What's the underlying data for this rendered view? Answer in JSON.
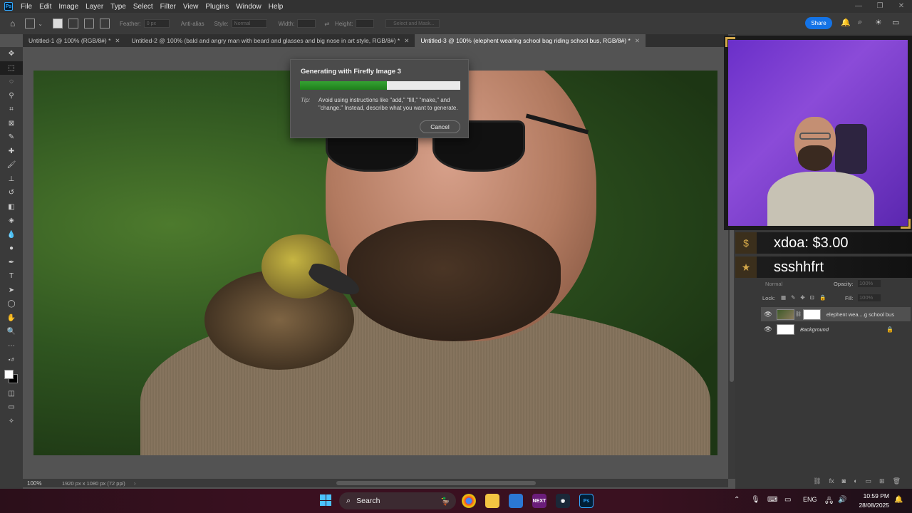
{
  "app": {
    "logo": "Ps",
    "menus": [
      "File",
      "Edit",
      "Image",
      "Layer",
      "Type",
      "Select",
      "Filter",
      "View",
      "Plugins",
      "Window",
      "Help"
    ]
  },
  "options_bar": {
    "feather_label": "Feather:",
    "feather_value": "0 px",
    "anti_alias_label": "Anti-alias",
    "style_label": "Style:",
    "style_value": "Normal",
    "width_label": "Width:",
    "height_label": "Height:",
    "select_mask_label": "Select and Mask...",
    "share_label": "Share"
  },
  "tabs": [
    {
      "label": "Untitled-1 @ 100% (RGB/8#) *",
      "active": false
    },
    {
      "label": "Untitled-2 @ 100% (bald and angry man with beard and glasses and big nose in art style, RGB/8#) *",
      "active": false
    },
    {
      "label": "Untitled-3 @ 100% (elephent wearing school bag riding school bus, RGB/8#) *",
      "active": true
    }
  ],
  "tools": [
    "move-tool",
    "marquee-tool",
    "lasso-tool",
    "object-select-tool",
    "crop-tool",
    "frame-tool",
    "eyedropper-tool",
    "spot-healing-tool",
    "brush-tool",
    "clone-stamp-tool",
    "history-brush-tool",
    "eraser-tool",
    "gradient-tool",
    "blur-tool",
    "dodge-tool",
    "pen-tool",
    "type-tool",
    "path-select-tool",
    "shape-tool",
    "hand-tool",
    "zoom-tool",
    "more-tools"
  ],
  "dialog": {
    "title": "Generating with Firefly Image 3",
    "progress": 0.54,
    "tip_label": "Tip:",
    "tip_text": "Avoid using instructions like \"add,\" \"fill,\" \"make,\" and \"change.\" Instead, describe what you want to generate.",
    "cancel_label": "Cancel"
  },
  "status": {
    "zoom": "100%",
    "doc_info": "1920 px x 1080 px (72 ppi)"
  },
  "stream_overlay": {
    "donation_1": "xdoa: $3.00",
    "donation_2": "ssshhfrt"
  },
  "layers_panel": {
    "blend_mode": "Normal",
    "opacity_label": "Opacity:",
    "opacity_value": "100%",
    "lock_label": "Lock:",
    "fill_label": "Fill:",
    "fill_value": "100%",
    "layers": [
      {
        "name": "elephent wea....g school bus",
        "selected": true
      },
      {
        "name": "Background",
        "selected": false
      }
    ]
  },
  "taskbar": {
    "search_label": "Search",
    "language": "ENG",
    "time": "10:59 PM",
    "date": "28/08/2025"
  }
}
